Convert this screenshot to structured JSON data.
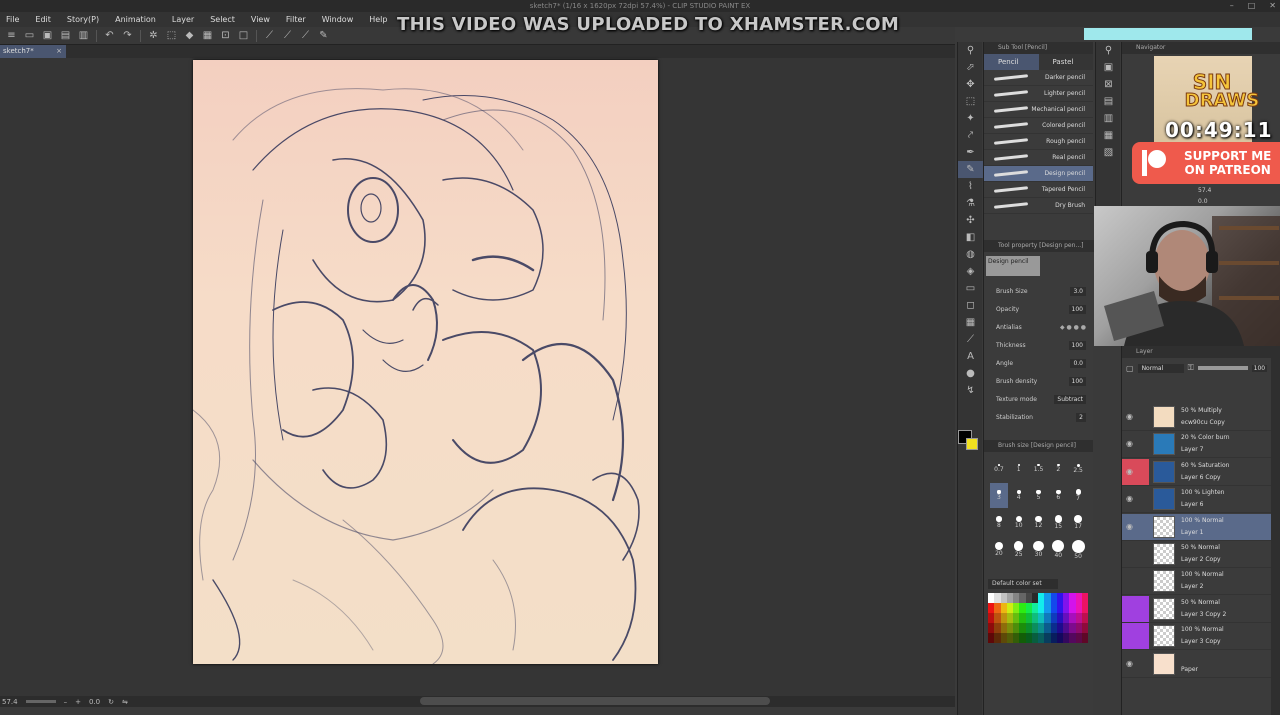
{
  "window": {
    "title": "sketch7* (1/16 x 1620px 72dpi 57.4%) - CLIP STUDIO PAINT EX",
    "controls": [
      "–",
      "□",
      "✕"
    ]
  },
  "menu": [
    "File",
    "Edit",
    "Story(P)",
    "Animation",
    "Layer",
    "Select",
    "View",
    "Filter",
    "Window",
    "Help"
  ],
  "watermark": "THIS VIDEO WAS UPLOADED TO XHAMSTER.COM",
  "document_tab": {
    "label": "sketch7*",
    "close": "×"
  },
  "statusbar": {
    "zoom": "57.4",
    "angle": "0.0"
  },
  "subtool_panel": {
    "header": "Sub Tool [Pencil]",
    "tabs": [
      "Pencil",
      "Pastel"
    ],
    "brushes": [
      "Darker pencil",
      "Lighter pencil",
      "Mechanical pencil",
      "Colored pencil",
      "Rough pencil",
      "Real pencil",
      "Design pencil",
      "Tapered Pencil",
      "Dry Brush"
    ],
    "active_brush_index": 6
  },
  "tool_property": {
    "header": "Tool property [Design pen...]",
    "preset": "Design pencil",
    "props": [
      {
        "label": "Brush Size",
        "value": "3.0"
      },
      {
        "label": "Opacity",
        "value": "100"
      },
      {
        "label": "Antialias",
        "value": ""
      },
      {
        "label": "Thickness",
        "value": "100"
      },
      {
        "label": "Angle",
        "value": "0.0"
      },
      {
        "label": "Brush density",
        "value": "100"
      },
      {
        "label": "Texture mode",
        "value": "Subtract"
      },
      {
        "label": "Stabilization",
        "value": "2"
      }
    ]
  },
  "brush_size_panel": {
    "header": "Brush size [Design pencil]",
    "sizes": [
      "0.7",
      "1",
      "1.5",
      "2",
      "2.5",
      "3",
      "4",
      "5",
      "6",
      "7",
      "8",
      "10",
      "12",
      "15",
      "17",
      "20",
      "25",
      "30",
      "40",
      "50"
    ],
    "active_index": 5
  },
  "color_panel": {
    "header": "Default color set"
  },
  "navigator": {
    "header": "Navigator",
    "zoom": "57.4",
    "angle": "0.0"
  },
  "overlay": {
    "logo_line1": "SIN",
    "logo_line2": "DRAWS",
    "timer": "00:49:11",
    "patreon_line1": "SUPPORT ME",
    "patreon_line2": "ON PATREON"
  },
  "layer_panel": {
    "header": "Layer",
    "blend_mode": "Normal",
    "opacity": "100",
    "layers": [
      {
        "mode": "50 % Multiply",
        "name": "ecw90cu Copy",
        "tag": "",
        "thumb": "#f3dcc0",
        "visible": true
      },
      {
        "mode": "20 % Color burn",
        "name": "Layer 7",
        "tag": "",
        "thumb": "#2a7ab8",
        "visible": true
      },
      {
        "mode": "60 % Saturation",
        "name": "Layer 6 Copy",
        "tag": "#d94a5a",
        "thumb": "#2a5a9a",
        "visible": true
      },
      {
        "mode": "100 % Lighten",
        "name": "Layer 6",
        "tag": "",
        "thumb": "#2a5a9a",
        "visible": true
      },
      {
        "mode": "100 % Normal",
        "name": "Layer 1",
        "tag": "",
        "thumb": "checker",
        "visible": true,
        "active": true
      },
      {
        "mode": "50 % Normal",
        "name": "Layer 2 Copy",
        "tag": "",
        "thumb": "checker",
        "visible": false
      },
      {
        "mode": "100 % Normal",
        "name": "Layer 2",
        "tag": "",
        "thumb": "checker",
        "visible": false
      },
      {
        "mode": "50 % Normal",
        "name": "Layer 3 Copy 2",
        "tag": "#a040e0",
        "thumb": "checker",
        "visible": false
      },
      {
        "mode": "100 % Normal",
        "name": "Layer 3 Copy",
        "tag": "#a040e0",
        "thumb": "checker",
        "visible": false
      },
      {
        "mode": "",
        "name": "Paper",
        "tag": "",
        "thumb": "#f8e0cc",
        "visible": true
      }
    ]
  },
  "colors": {
    "accent": "#4a5670",
    "active_row": "#5a6a8a",
    "patreon": "#ef5a4c",
    "cyan_bar": "#9fe8ec",
    "canvas": "#f3d6c4"
  }
}
